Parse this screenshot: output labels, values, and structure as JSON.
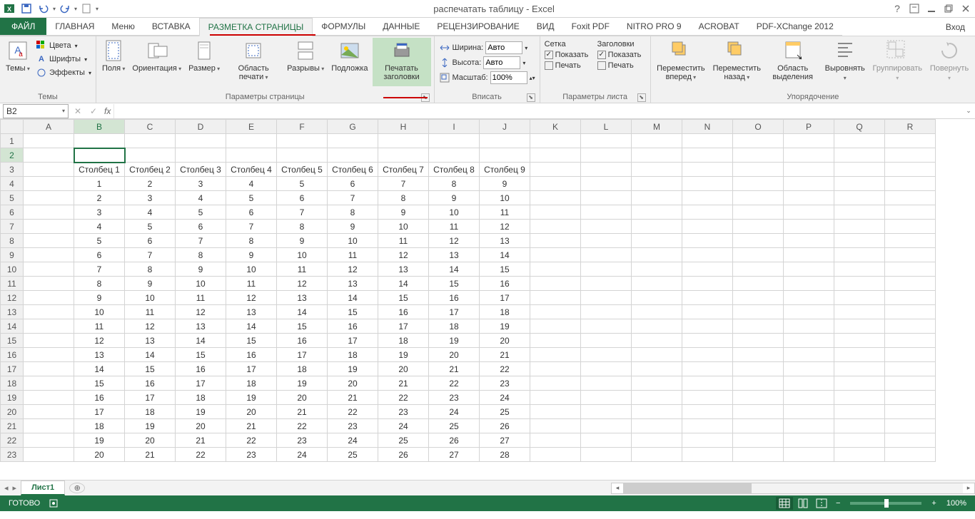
{
  "app": {
    "title": "распечатать таблицу - Excel"
  },
  "qat": {
    "save": "save",
    "undo": "undo",
    "redo": "redo",
    "new": "new"
  },
  "tabs": {
    "file": "ФАЙЛ",
    "list": [
      "ГЛАВНАЯ",
      "Меню",
      "ВСТАВКА",
      "РАЗМЕТКА СТРАНИЦЫ",
      "ФОРМУЛЫ",
      "ДАННЫЕ",
      "РЕЦЕНЗИРОВАНИЕ",
      "ВИД",
      "Foxit PDF",
      "NITRO PRO 9",
      "ACROBAT",
      "PDF-XChange 2012"
    ],
    "active_index": 3,
    "signin": "Вход"
  },
  "ribbon": {
    "themes": {
      "label": "Темы",
      "themes_btn": "Темы",
      "colors": "Цвета",
      "fonts": "Шрифты",
      "effects": "Эффекты"
    },
    "page_setup": {
      "label": "Параметры страницы",
      "margins": "Поля",
      "orientation": "Ориентация",
      "size": "Размер",
      "print_area": "Область печати",
      "breaks": "Разрывы",
      "background": "Подложка",
      "print_titles": "Печатать заголовки"
    },
    "scale": {
      "label": "Вписать",
      "width": "Ширина:",
      "height": "Высота:",
      "scale": "Масштаб:",
      "width_val": "Авто",
      "height_val": "Авто",
      "scale_val": "100%"
    },
    "sheet_options": {
      "label": "Параметры листа",
      "gridlines": "Сетка",
      "headings": "Заголовки",
      "show": "Показать",
      "print": "Печать"
    },
    "arrange": {
      "label": "Упорядочение",
      "bring_forward": "Переместить вперед",
      "send_backward": "Переместить назад",
      "selection_pane": "Область выделения",
      "align": "Выровнять",
      "group": "Группировать",
      "rotate": "Повернуть"
    }
  },
  "formula_bar": {
    "cell_ref": "B2",
    "formula": ""
  },
  "columns": [
    "A",
    "B",
    "C",
    "D",
    "E",
    "F",
    "G",
    "H",
    "I",
    "J",
    "K",
    "L",
    "M",
    "N",
    "O",
    "P",
    "Q",
    "R"
  ],
  "row_count": 23,
  "headers_row": 3,
  "headers": [
    "Столбец 1",
    "Столбец 2",
    "Столбец 3",
    "Столбец 4",
    "Столбец 5",
    "Столбец 6",
    "Столбец 7",
    "Столбец 8",
    "Столбец 9"
  ],
  "data_start_row": 4,
  "data_rows": 20,
  "selected": {
    "col": "B",
    "row": 2
  },
  "page_break_after_col": "I",
  "sheets": {
    "active": "Лист1"
  },
  "status": {
    "ready": "ГОТОВО",
    "zoom": "100%"
  }
}
